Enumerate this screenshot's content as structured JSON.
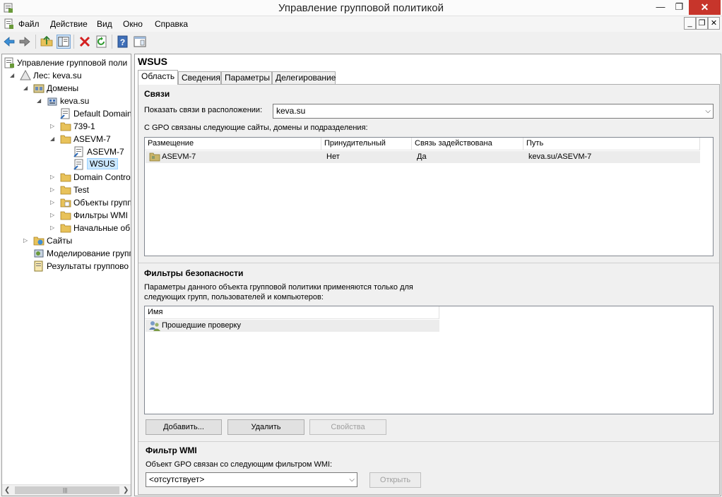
{
  "window": {
    "title": "Управление групповой политикой"
  },
  "menu": [
    "Файл",
    "Действие",
    "Вид",
    "Окно",
    "Справка"
  ],
  "tree": [
    {
      "label": "Управление групповой поли",
      "level": 0,
      "expander": "",
      "icon": "gpm-icon"
    },
    {
      "label": "Лес: keva.su",
      "level": 1,
      "expander": "open",
      "icon": "forest-icon"
    },
    {
      "label": "Домены",
      "level": 2,
      "expander": "open",
      "icon": "domains-icon"
    },
    {
      "label": "keva.su",
      "level": 3,
      "expander": "open",
      "icon": "domain-icon"
    },
    {
      "label": "Default Domain",
      "level": 4,
      "expander": "",
      "icon": "gpo-link-icon"
    },
    {
      "label": "739-1",
      "level": 4,
      "expander": "closed",
      "icon": "folder-icon"
    },
    {
      "label": "ASEVM-7",
      "level": 4,
      "expander": "open",
      "icon": "folder-icon"
    },
    {
      "label": "ASEVM-7",
      "level": 5,
      "expander": "",
      "icon": "gpo-link-icon"
    },
    {
      "label": "WSUS",
      "level": 5,
      "expander": "",
      "icon": "gpo-link-icon",
      "selected": true
    },
    {
      "label": "Domain Contro",
      "level": 4,
      "expander": "closed",
      "icon": "folder-icon"
    },
    {
      "label": "Test",
      "level": 4,
      "expander": "closed",
      "icon": "folder-icon"
    },
    {
      "label": "Объекты групп",
      "level": 4,
      "expander": "closed",
      "icon": "gpo-folder-icon"
    },
    {
      "label": "Фильтры WMI",
      "level": 4,
      "expander": "closed",
      "icon": "folder-icon"
    },
    {
      "label": "Начальные об",
      "level": 4,
      "expander": "closed",
      "icon": "folder-icon"
    },
    {
      "label": "Сайты",
      "level": 2,
      "expander": "closed",
      "icon": "sites-icon"
    },
    {
      "label": "Моделирование групп",
      "level": 2,
      "expander": "",
      "icon": "modeling-icon"
    },
    {
      "label": "Результаты группово",
      "level": 2,
      "expander": "",
      "icon": "results-icon"
    }
  ],
  "gpo": {
    "name": "WSUS",
    "tabs": [
      "Область",
      "Сведения",
      "Параметры",
      "Делегирование"
    ],
    "links": {
      "title": "Связи",
      "location_label": "Показать связи в расположении:",
      "location_value": "keva.su",
      "desc": "С GPO связаны следующие сайты, домены и подразделения:",
      "columns": [
        "Размещение",
        "Принудительный",
        "Связь задействована",
        "Путь"
      ],
      "rows": [
        [
          "ASEVM-7",
          "Нет",
          "Да",
          "keva.su/ASEVM-7"
        ]
      ]
    },
    "security": {
      "title": "Фильтры безопасности",
      "desc_line1": "Параметры данного объекта групповой политики применяются только для",
      "desc_line2": "следующих групп, пользователей и компьютеров:",
      "column": "Имя",
      "rows": [
        "Прошедшие проверку"
      ],
      "add_label": "Добавить...",
      "remove_label": "Удалить",
      "props_label": "Свойства"
    },
    "wmi": {
      "title": "Фильтр WMI",
      "desc": "Объект GPO связан со следующим фильтром WMI:",
      "value": "<отсутствует>",
      "open_label": "Открыть"
    }
  }
}
